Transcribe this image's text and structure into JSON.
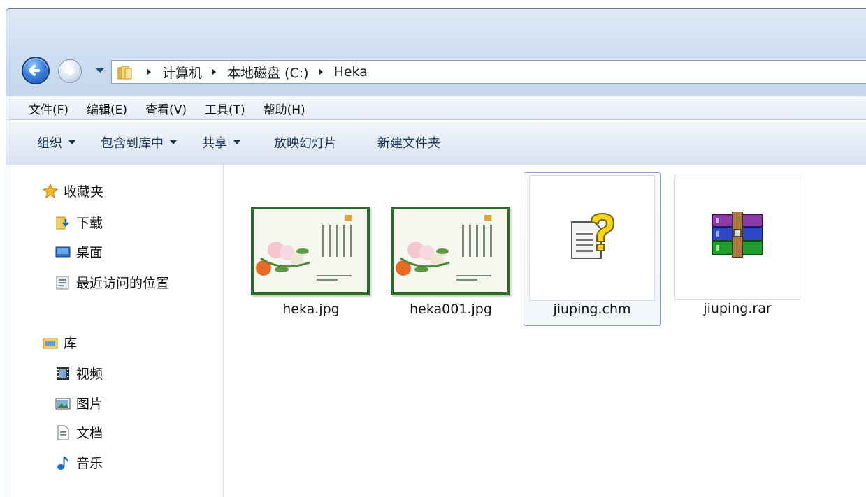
{
  "window": {
    "title": ""
  },
  "nav": {
    "back_label": "",
    "breadcrumbs": [
      "计算机",
      "本地磁盘 (C:)",
      "Heka"
    ]
  },
  "menubar": {
    "items": [
      "文件(F)",
      "编辑(E)",
      "查看(V)",
      "工具(T)",
      "帮助(H)"
    ]
  },
  "commandbar": {
    "organize": "组织",
    "include_library": "包含到库中",
    "share": "共享",
    "slideshow": "放映幻灯片",
    "new_folder": "新建文件夹"
  },
  "sidebar": {
    "favorites": {
      "label": "收藏夹",
      "items": [
        "下载",
        "桌面",
        "最近访问的位置"
      ]
    },
    "libraries": {
      "label": "库",
      "items": [
        "视频",
        "图片",
        "文档",
        "音乐"
      ]
    }
  },
  "files": [
    {
      "name": "heka.jpg",
      "icon": "image-thumbnail"
    },
    {
      "name": "heka001.jpg",
      "icon": "image-thumbnail"
    },
    {
      "name": "jiuping.chm",
      "icon": "chm-help-icon",
      "selected": true
    },
    {
      "name": "jiuping.rar",
      "icon": "winrar-archive-icon"
    }
  ],
  "colors": {
    "accent": "#3c82e0",
    "selection_border": "#7da2ce",
    "command_text": "#1e3a60"
  }
}
